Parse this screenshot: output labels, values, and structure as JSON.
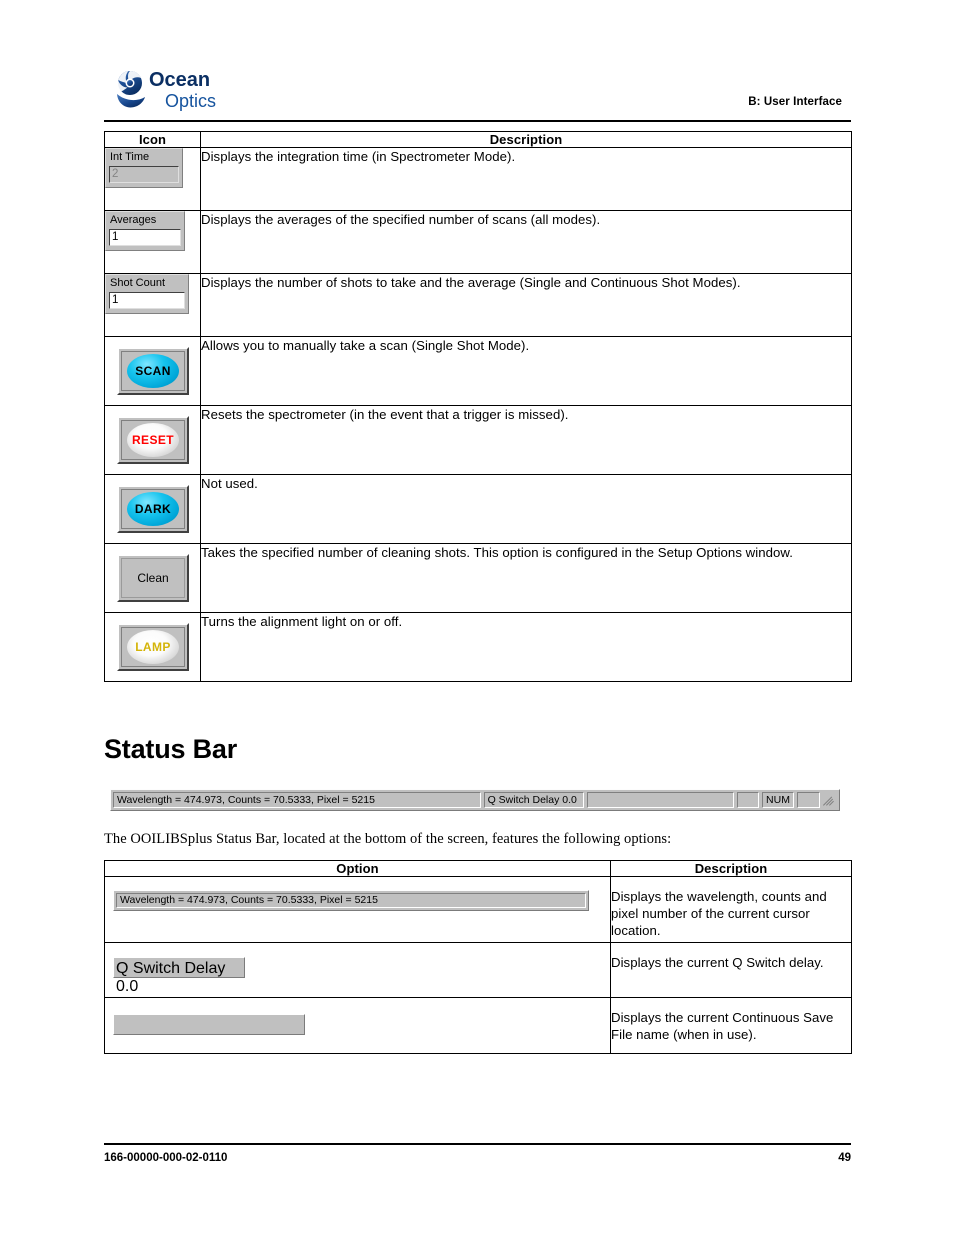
{
  "header": {
    "logo_primary": "Ocean",
    "logo_secondary": "Optics",
    "title": "B: User Interface"
  },
  "icon_table": {
    "columns": [
      "Icon",
      "Description"
    ],
    "rows": [
      {
        "widget_kind": "labelled-field",
        "widget_label": "Int Time",
        "widget_value": "2",
        "widget_state": "disabled",
        "description": "Displays the integration time (in Spectrometer Mode)."
      },
      {
        "widget_kind": "labelled-field",
        "widget_label": "Averages",
        "widget_value": "1",
        "widget_state": "enabled",
        "description": "Displays the averages of the specified number of scans (all modes)."
      },
      {
        "widget_kind": "labelled-field",
        "widget_label": "Shot Count",
        "widget_value": "1",
        "widget_state": "enabled",
        "description": "Displays the number of shots to take and the average (Single and Continuous Shot Modes)."
      },
      {
        "widget_kind": "led-button",
        "widget_label": "SCAN",
        "widget_style": "cyan",
        "description": "Allows you to manually take a scan (Single Shot Mode)."
      },
      {
        "widget_kind": "led-button",
        "widget_label": "RESET",
        "widget_style": "white",
        "description": "Resets the spectrometer (in the event that a trigger is missed)."
      },
      {
        "widget_kind": "led-button",
        "widget_label": "DARK",
        "widget_style": "cyan",
        "description": "Not used."
      },
      {
        "widget_kind": "plain-button",
        "widget_label": "Clean",
        "description": "Takes the specified number of cleaning shots. This option is configured in the Setup Options window."
      },
      {
        "widget_kind": "led-button",
        "widget_label": "LAMP",
        "widget_style": "lamp",
        "description": "Turns the alignment light on or off."
      }
    ]
  },
  "section": {
    "heading": "Status Bar",
    "intro": "The OOILIBSplus Status Bar, located at the bottom of the screen, features the following options:"
  },
  "status_bar": {
    "wavelength_pane": "Wavelength = 474.973, Counts = 70.5333, Pixel = 5215",
    "qswitch_pane": "Q Switch Delay 0.0",
    "file_pane": "",
    "spacer_pane": "",
    "num_pane": "NUM",
    "trailing_pane": "",
    "grip": "resize-grip"
  },
  "option_table": {
    "columns": [
      "Option",
      "Description"
    ],
    "rows": [
      {
        "widget_kind": "status-pane-wide",
        "widget_label": "Wavelength = 474.973, Counts = 70.5333, Pixel = 5215",
        "description": "Displays the wavelength, counts and pixel number of the current cursor location."
      },
      {
        "widget_kind": "status-pane-small",
        "widget_label": "Q Switch Delay 0.0",
        "description": "Displays the current Q Switch delay."
      },
      {
        "widget_kind": "status-pane-empty",
        "widget_label": "",
        "description": "Displays the current Continuous Save File name (when in use)."
      }
    ]
  },
  "footer": {
    "doc_number": "166-00000-000-02-0110",
    "page_number": "49"
  },
  "colors": {
    "led_cyan": "#00a6d8",
    "reset_red": "#ff0000",
    "lamp_gold": "#d4b40a",
    "win95_face": "#c0c0c0"
  }
}
